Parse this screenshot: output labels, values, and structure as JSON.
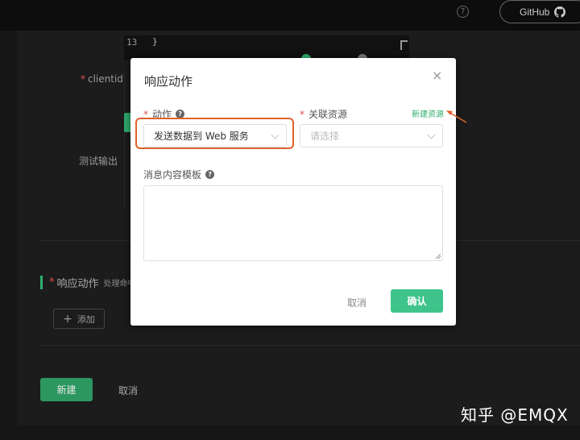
{
  "topbar": {
    "help_icon": "?",
    "github_label": "GitHub"
  },
  "editor": {
    "line_number": "13",
    "code_line": "}"
  },
  "form": {
    "clientid_label": "clientid",
    "test_output_label": "测试输出",
    "actions_section_title": "响应动作",
    "actions_section_hint": "处理命中",
    "add_button": "添加",
    "create_button": "新建",
    "cancel_button": "取消"
  },
  "modal": {
    "title": "响应动作",
    "close_icon": "×",
    "action_label": "动作",
    "action_help": "?",
    "action_value": "发送数据到 Web 服务",
    "resource_label": "关联资源",
    "new_resource_link": "新建资源",
    "resource_placeholder": "请选择",
    "template_label": "消息内容模板",
    "template_help": "?",
    "template_value": "",
    "cancel_button": "取消",
    "confirm_button": "确认"
  },
  "watermark": "知乎 @EMQX",
  "colors": {
    "accent_green": "#3ec48a",
    "highlight_orange": "#e0622c",
    "required_star": "#e05050"
  }
}
